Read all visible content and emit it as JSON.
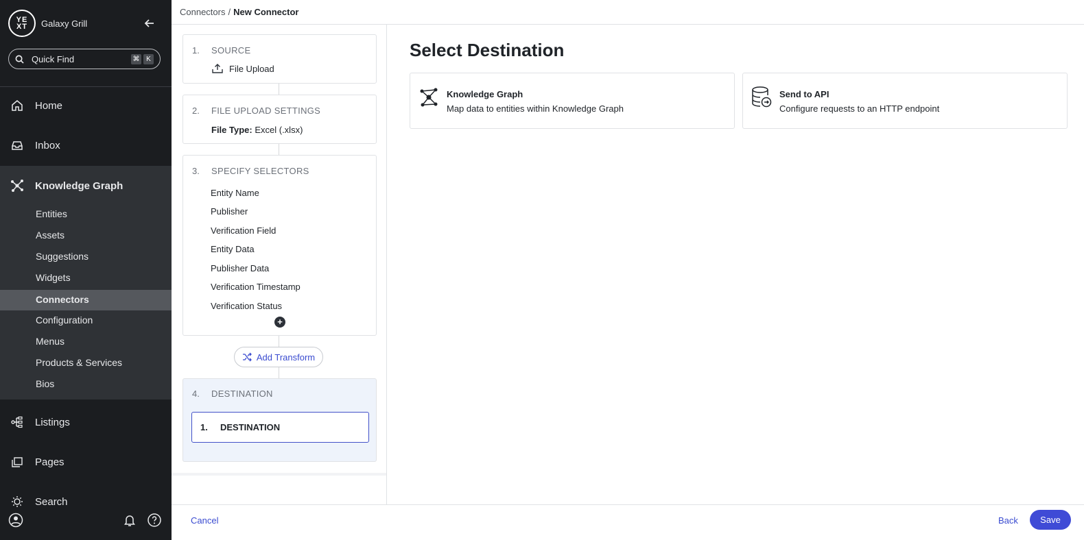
{
  "app": {
    "brand_name": "Galaxy Grill",
    "logo_text": "YEXT"
  },
  "quick_find": {
    "label": "Quick Find",
    "shortcut_keys": [
      "⌘",
      "K"
    ]
  },
  "nav": {
    "home": "Home",
    "inbox": "Inbox",
    "knowledge_graph": "Knowledge Graph",
    "knowledge_graph_sub": [
      "Entities",
      "Assets",
      "Suggestions",
      "Widgets",
      "Connectors",
      "Configuration",
      "Menus",
      "Products & Services",
      "Bios"
    ],
    "active_sub": "Connectors",
    "listings": "Listings",
    "pages": "Pages",
    "search": "Search"
  },
  "breadcrumb": {
    "parent": "Connectors",
    "separator": "/",
    "current": "New Connector"
  },
  "steps": {
    "source": {
      "num": "1.",
      "title": "SOURCE",
      "value": "File Upload"
    },
    "settings": {
      "num": "2.",
      "title": "FILE UPLOAD SETTINGS",
      "file_type_label": "File Type:",
      "file_type_value": "Excel (.xlsx)"
    },
    "selectors": {
      "num": "3.",
      "title": "SPECIFY SELECTORS",
      "items": [
        "Entity Name",
        "Publisher",
        "Verification Field",
        "Entity Data",
        "Publisher Data",
        "Verification Timestamp",
        "Verification Status"
      ]
    },
    "add_transform": "Add Transform",
    "destination": {
      "num": "4.",
      "title": "DESTINATION",
      "inner_num": "1.",
      "inner_title": "DESTINATION"
    }
  },
  "main": {
    "title": "Select Destination",
    "options": [
      {
        "title": "Knowledge Graph",
        "description": "Map data to entities within Knowledge Graph",
        "icon": "knowledge-graph-icon"
      },
      {
        "title": "Send to API",
        "description": "Configure requests to an HTTP endpoint",
        "icon": "database-api-icon"
      }
    ]
  },
  "footer": {
    "cancel": "Cancel",
    "back": "Back",
    "save": "Save"
  },
  "colors": {
    "sidebar_bg": "#1b1d20",
    "sidebar_section_bg": "#2f3236",
    "sidebar_active_bg": "#55585d",
    "accent": "#3f4bd6",
    "destination_bg": "#eef3fb"
  }
}
